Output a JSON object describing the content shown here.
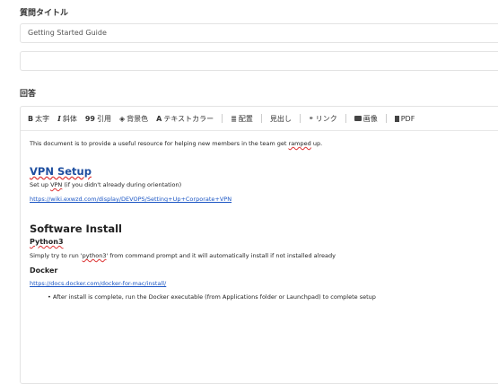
{
  "question_label": "質問タイトル",
  "title_value": "Getting Started Guide",
  "answer_label": "回答",
  "toolbar": {
    "bold": {
      "icon": "B",
      "label": "太字"
    },
    "italic": {
      "icon": "I",
      "label": "斜体"
    },
    "quote": {
      "icon": "99",
      "label": "引用"
    },
    "bgcolor": {
      "icon": "◈",
      "label": "背景色"
    },
    "textcolor": {
      "icon": "A",
      "label": "テキストカラー"
    },
    "align": {
      "icon": "≣",
      "label": "配置"
    },
    "heading": {
      "label": "見出し"
    },
    "link": {
      "icon": "🔗",
      "label": "リンク"
    },
    "image": {
      "icon": "🖼",
      "label": "画像"
    },
    "pdf": {
      "icon": "▌",
      "label": "PDF"
    }
  },
  "content": {
    "intro_before": "This document is to provide a useful resource for helping new members in the team get ",
    "intro_misspelled": "ramped",
    "intro_after": " up.",
    "vpn_heading": "VPN Setup",
    "vpn_text_before": "Set up ",
    "vpn_text_word": "VPN",
    "vpn_text_after": " (if you didn't already during orientation)",
    "vpn_link": "https://wiki.exwzd.com/display/DEVOPS/Setting+Up+Corporate+VPN",
    "software_heading": "Software Install",
    "python_heading": "Python3",
    "python_before": "Simply try to run '",
    "python_word": "python3",
    "python_after": "' from command prompt and it will automatically install if not installed already",
    "docker_heading": "Docker",
    "docker_link": "https://docs.docker.com/docker-for-mac/install/",
    "docker_bullet": "After install is complete, run the Docker executable (from Applications folder or Launchpad) to complete setup"
  }
}
